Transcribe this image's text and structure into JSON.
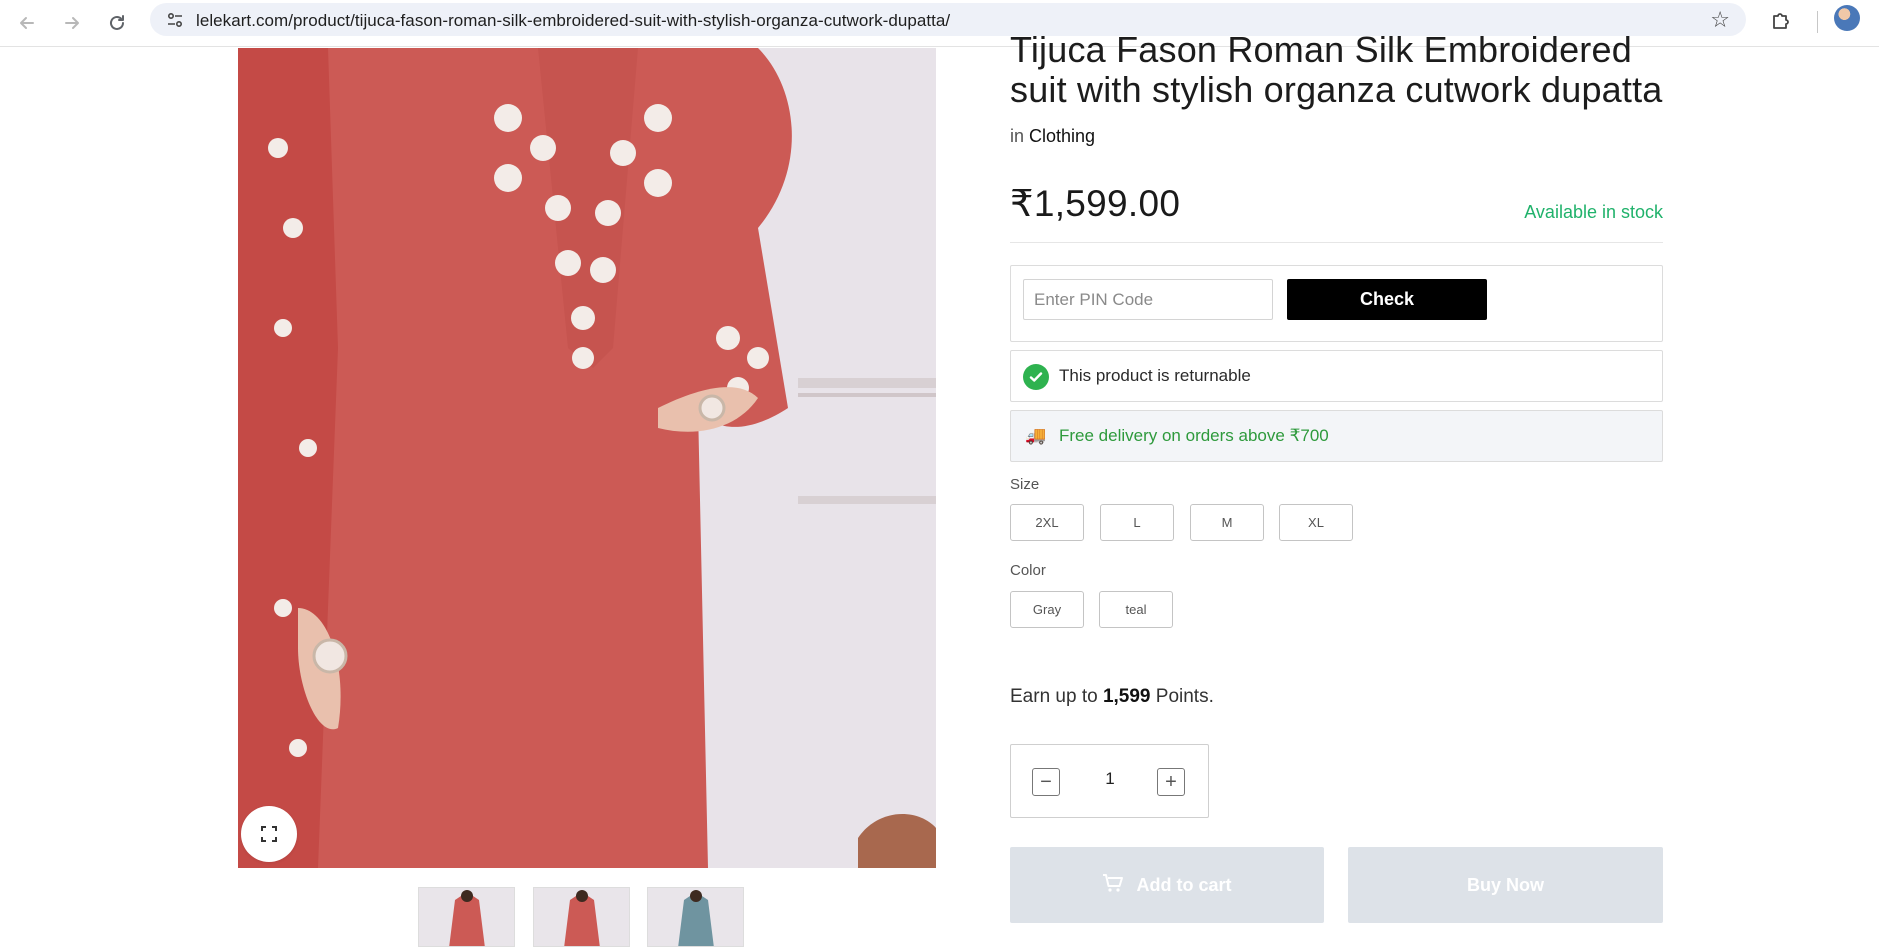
{
  "browser": {
    "url": "lelekart.com/product/tijuca-fason-roman-silk-embroidered-suit-with-stylish-organza-cutwork-dupatta/",
    "back_icon": "arrow-left-icon",
    "forward_icon": "arrow-right-icon",
    "reload_icon": "reload-icon",
    "bookmark_icon": "star-icon"
  },
  "product": {
    "title": "Tijuca Fason Roman Silk Embroidered suit with stylish organza cutwork dupatta",
    "category_prefix": "in",
    "category": "Clothing",
    "price": "₹1,599.00",
    "stock_status": "Available in stock",
    "stock_color": "#20b26b",
    "image_colors": [
      "#cc5a55",
      "#cc5a55",
      "#6f94a0"
    ]
  },
  "pincode": {
    "placeholder": "Enter PIN Code",
    "value": "",
    "button_label": "Check"
  },
  "returnable": {
    "text": "This product is returnable"
  },
  "delivery": {
    "text": "Free delivery on orders above ₹700"
  },
  "options": {
    "size_label": "Size",
    "sizes": [
      "2XL",
      "L",
      "M",
      "XL"
    ],
    "color_label": "Color",
    "colors": [
      "Gray",
      "teal"
    ]
  },
  "points": {
    "prefix": "Earn up to",
    "value": "1,599",
    "suffix": "Points."
  },
  "quantity": {
    "value": "1",
    "minus_label": "−",
    "plus_label": "+"
  },
  "actions": {
    "add_to_cart": "Add to cart",
    "buy_now": "Buy Now"
  }
}
